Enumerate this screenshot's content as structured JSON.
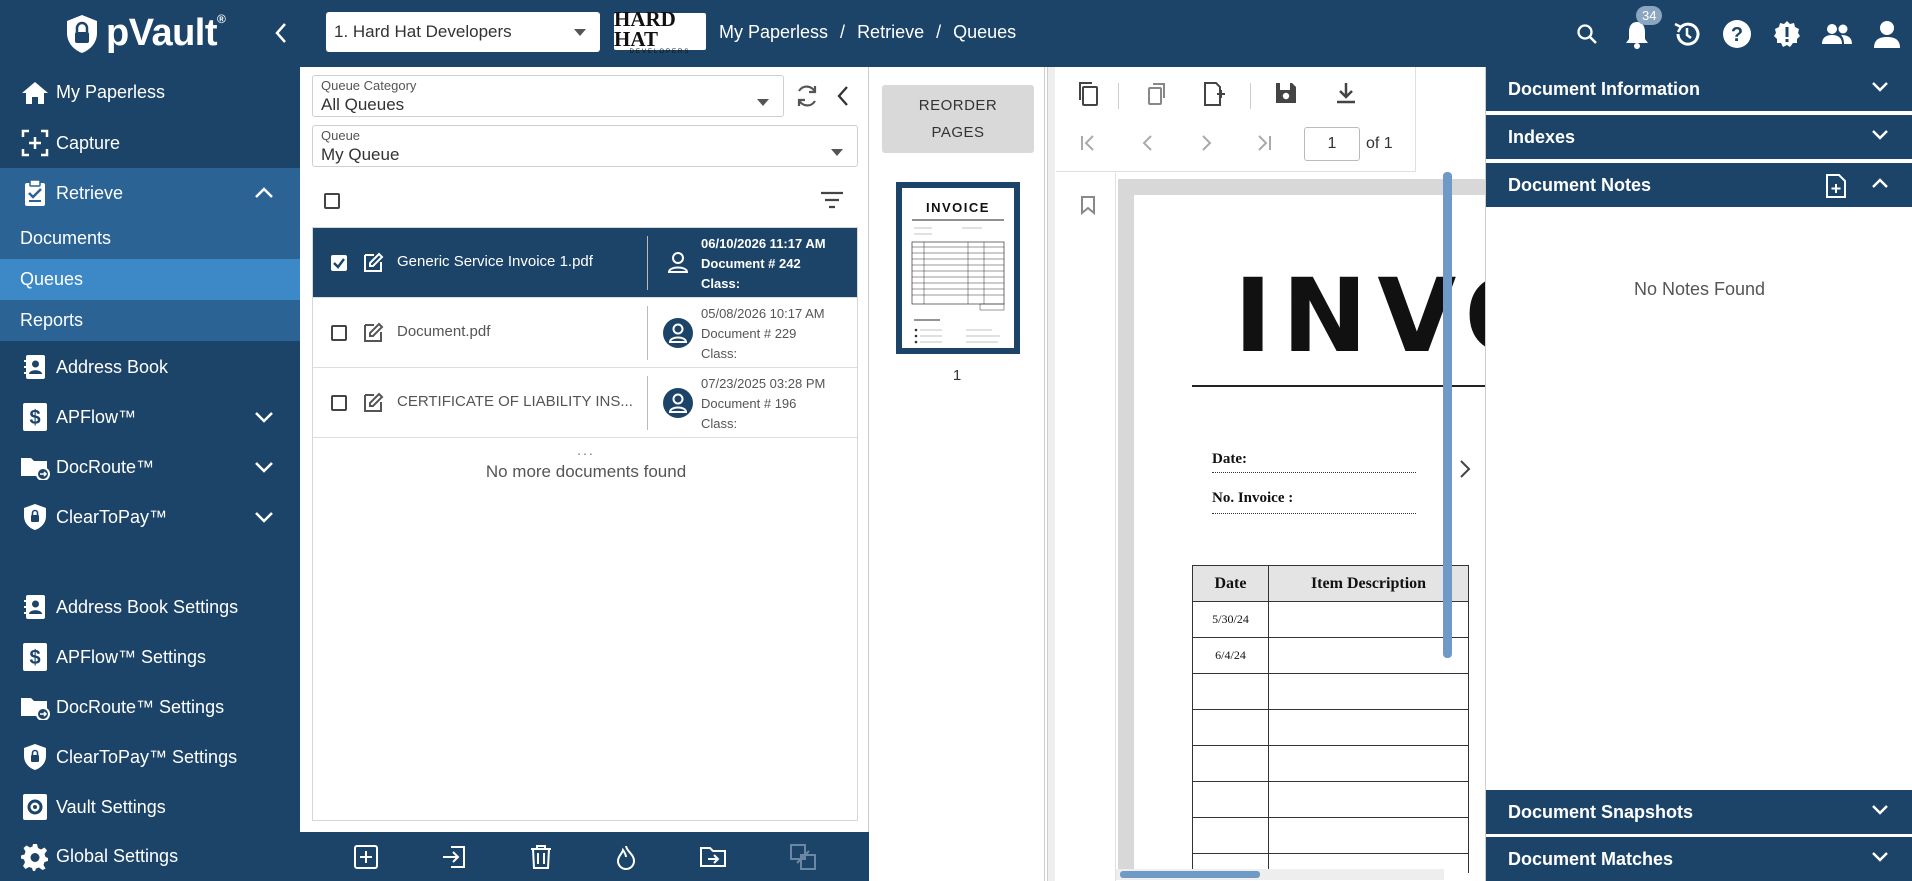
{
  "app": {
    "logo_text": "pVault",
    "trademark": "®"
  },
  "topbar": {
    "tenant_select": "1. Hard Hat Developers",
    "brand_logo": {
      "main": "HARD HAT",
      "sub": "DEVELOPERS"
    },
    "breadcrumb": [
      "My Paperless",
      "/",
      "Retrieve",
      "/",
      "Queues"
    ],
    "notification_count": "34",
    "icons": [
      "search-icon",
      "bell-icon",
      "history-icon",
      "help-icon",
      "alert-icon",
      "users-icon",
      "account-icon"
    ]
  },
  "sidebar": {
    "items": [
      {
        "label": "My Paperless",
        "icon": "home-icon"
      },
      {
        "label": "Capture",
        "icon": "capture-icon"
      },
      {
        "label": "Retrieve",
        "icon": "retrieve-icon"
      },
      {
        "label": "Address Book",
        "icon": "address-book-icon"
      },
      {
        "label": "APFlow™",
        "icon": "apflow-icon"
      },
      {
        "label": "DocRoute™",
        "icon": "docroute-icon"
      },
      {
        "label": "ClearToPay™",
        "icon": "cleartopay-icon"
      }
    ],
    "retrieve_sub": [
      "Documents",
      "Queues",
      "Reports"
    ],
    "settings": [
      {
        "label": "Address Book Settings",
        "icon": "address-book-icon"
      },
      {
        "label": "APFlow™ Settings",
        "icon": "apflow-icon"
      },
      {
        "label": "DocRoute™ Settings",
        "icon": "docroute-icon"
      },
      {
        "label": "ClearToPay™ Settings",
        "icon": "cleartopay-icon"
      },
      {
        "label": "Vault Settings",
        "icon": "gear-icon"
      },
      {
        "label": "Global Settings",
        "icon": "gear-icon"
      }
    ]
  },
  "queues": {
    "category_label": "Queue Category",
    "category_value": "All Queues",
    "queue_label": "Queue",
    "queue_value": "My Queue",
    "documents": [
      {
        "name": "Generic Service Invoice 1.pdf",
        "date": "06/10/2026 11:17 AM",
        "docnum": "Document # 242",
        "class": "Class:",
        "selected": true
      },
      {
        "name": "Document.pdf",
        "date": "05/08/2026 10:17 AM",
        "docnum": "Document # 229",
        "class": "Class:",
        "selected": false
      },
      {
        "name": "CERTIFICATE OF LIABILITY INS...",
        "date": "07/23/2025 03:28 PM",
        "docnum": "Document # 196",
        "class": "Class:",
        "selected": false
      }
    ],
    "ellipsis": "...",
    "no_more": "No more documents found"
  },
  "thumbnails": {
    "reorder_label_1": "REORDER",
    "reorder_label_2": "PAGES",
    "thumb_title": "INVOICE",
    "page_number": "1"
  },
  "viewer": {
    "page_input": "1",
    "page_of": "of 1",
    "invoice": {
      "title": "INVOICE",
      "date_label": "Date:",
      "no_label": "No. Invoice :",
      "col_date": "Date",
      "col_desc": "Item Description",
      "rows": [
        "5/30/24",
        "6/4/24",
        "",
        "",
        "",
        "",
        "",
        ""
      ]
    }
  },
  "right_panel": {
    "sections_top": [
      "Document Information",
      "Indexes",
      "Document Notes"
    ],
    "no_notes": "No Notes Found",
    "sections_bottom": [
      "Document Snapshots",
      "Document Matches"
    ]
  },
  "colors": {
    "navy": "#1c4468",
    "active": "#2a6394",
    "selected": "#3d88c6"
  }
}
